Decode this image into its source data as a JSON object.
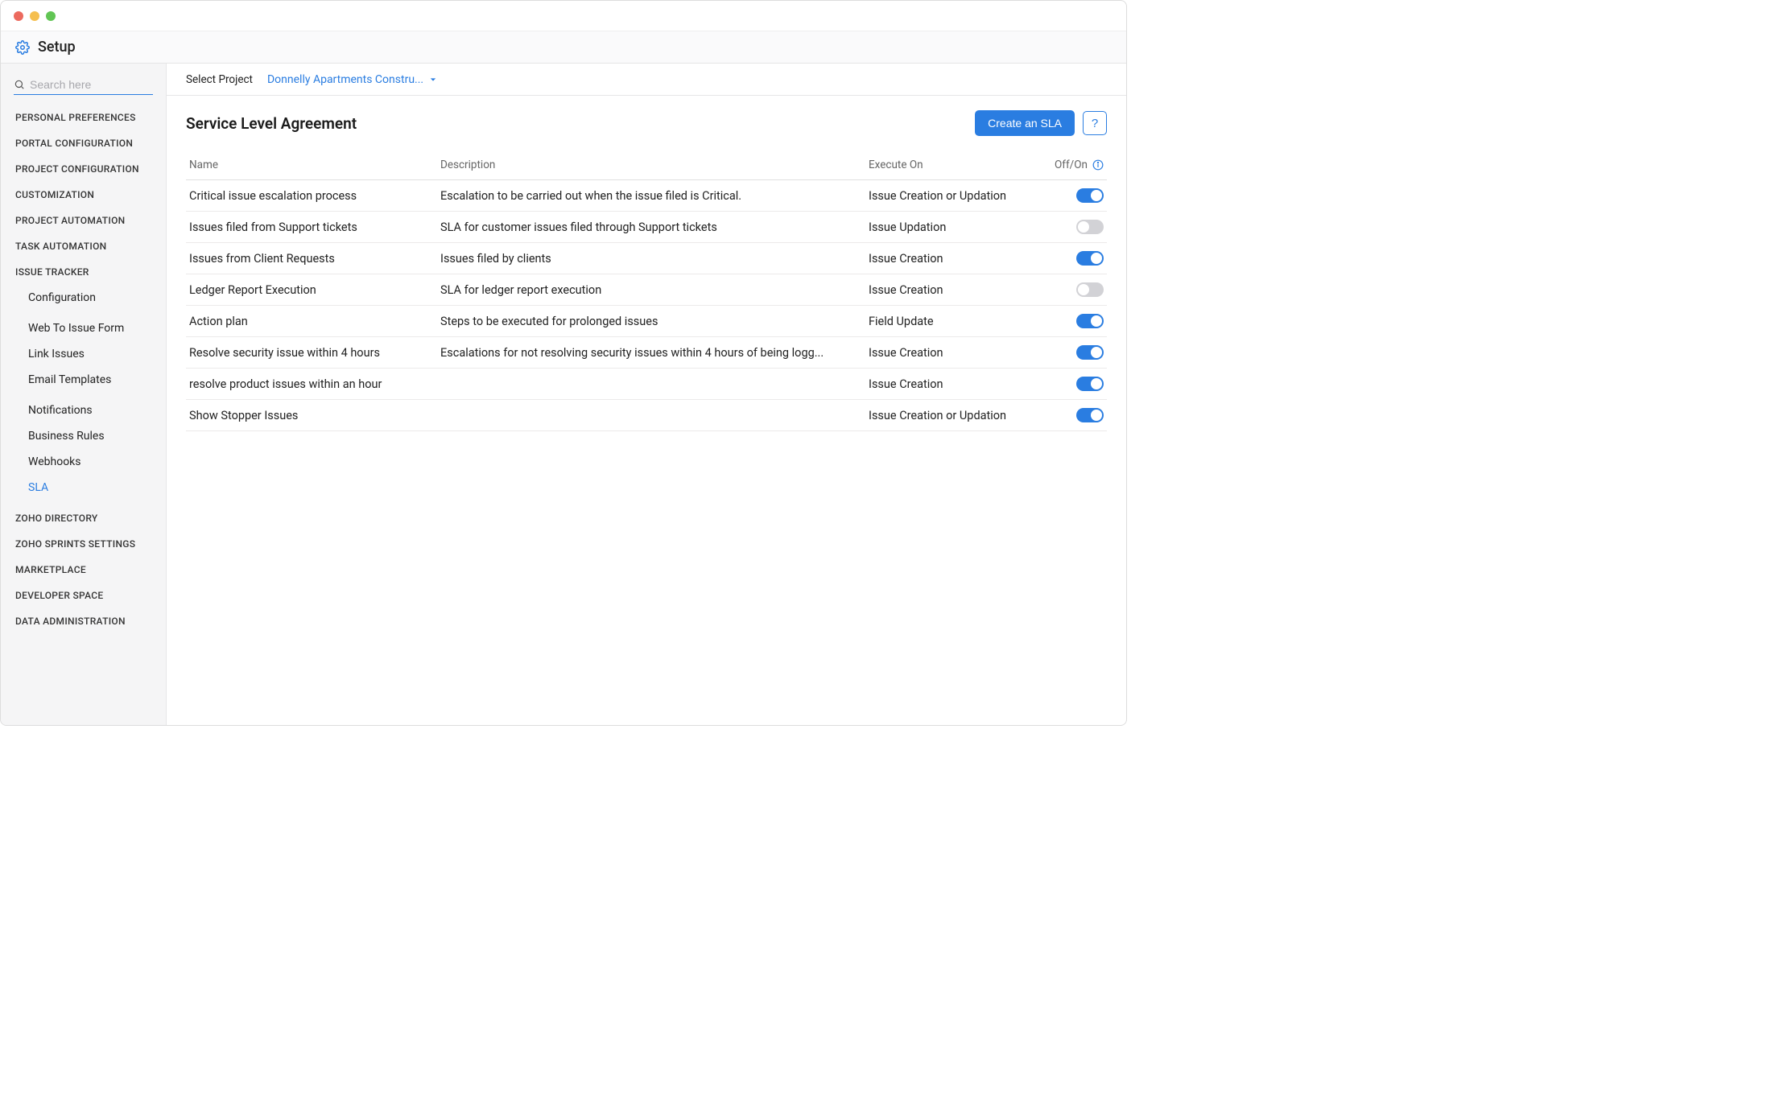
{
  "header": {
    "title": "Setup"
  },
  "sidebar": {
    "search_placeholder": "Search here",
    "sections": [
      {
        "label": "PERSONAL PREFERENCES"
      },
      {
        "label": "PORTAL CONFIGURATION"
      },
      {
        "label": "PROJECT CONFIGURATION"
      },
      {
        "label": "CUSTOMIZATION"
      },
      {
        "label": "PROJECT AUTOMATION"
      },
      {
        "label": "TASK AUTOMATION"
      },
      {
        "label": "ISSUE TRACKER",
        "children_groups": [
          [
            "Configuration"
          ],
          [
            "Web To Issue Form",
            "Link Issues",
            "Email Templates"
          ],
          [
            "Notifications",
            "Business Rules",
            "Webhooks",
            "SLA"
          ]
        ],
        "active_child": "SLA"
      },
      {
        "label": "ZOHO DIRECTORY"
      },
      {
        "label": "ZOHO SPRINTS SETTINGS"
      },
      {
        "label": "MARKETPLACE"
      },
      {
        "label": "DEVELOPER SPACE"
      },
      {
        "label": "DATA ADMINISTRATION"
      }
    ]
  },
  "project_bar": {
    "label": "Select Project",
    "value": "Donnelly Apartments Constru..."
  },
  "main": {
    "title": "Service Level Agreement",
    "create_button": "Create an SLA",
    "help_button": "?",
    "columns": {
      "name": "Name",
      "description": "Description",
      "execute_on": "Execute On",
      "off_on": "Off/On"
    },
    "rows": [
      {
        "name": "Critical issue escalation process",
        "description": "Escalation to be carried out when the issue filed is Critical.",
        "execute_on": "Issue Creation or Updation",
        "on": true
      },
      {
        "name": "Issues filed from Support tickets",
        "description": "SLA for customer issues filed through Support tickets",
        "execute_on": "Issue Updation",
        "on": false
      },
      {
        "name": "Issues from Client Requests",
        "description": "Issues filed by clients",
        "execute_on": "Issue Creation",
        "on": true
      },
      {
        "name": "Ledger Report Execution",
        "description": "SLA for ledger report execution",
        "execute_on": "Issue Creation",
        "on": false
      },
      {
        "name": "Action plan",
        "description": "Steps to be executed for prolonged issues",
        "execute_on": "Field Update",
        "on": true
      },
      {
        "name": "Resolve security issue within 4 hours",
        "description": "Escalations for not resolving security issues within 4 hours of being logg...",
        "execute_on": "Issue Creation",
        "on": true
      },
      {
        "name": "resolve product issues within an hour",
        "description": "",
        "execute_on": "Issue Creation",
        "on": true
      },
      {
        "name": "Show Stopper Issues",
        "description": "",
        "execute_on": "Issue Creation or Updation",
        "on": true
      }
    ]
  }
}
